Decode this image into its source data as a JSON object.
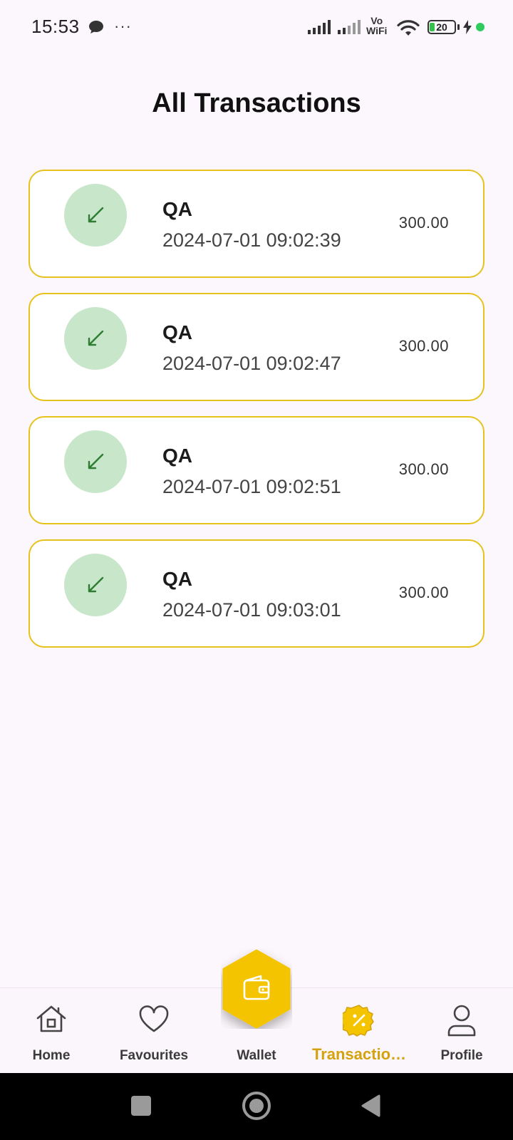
{
  "status_bar": {
    "time": "15:53",
    "more": "···",
    "vo": "Vo",
    "wifi_text": "WiFi",
    "battery": "20"
  },
  "page": {
    "title": "All Transactions"
  },
  "transactions": [
    {
      "name": "QA",
      "date": "2024-07-01 09:02:39",
      "amount": "300.00",
      "icon": "arrow-down-left-icon"
    },
    {
      "name": "QA",
      "date": "2024-07-01 09:02:47",
      "amount": "300.00",
      "icon": "arrow-down-left-icon"
    },
    {
      "name": "QA",
      "date": "2024-07-01 09:02:51",
      "amount": "300.00",
      "icon": "arrow-down-left-icon"
    },
    {
      "name": "QA",
      "date": "2024-07-01 09:03:01",
      "amount": "300.00",
      "icon": "arrow-down-left-icon"
    }
  ],
  "bottom_nav": {
    "items": [
      {
        "label": "Home",
        "icon": "home-icon"
      },
      {
        "label": "Favourites",
        "icon": "heart-icon"
      },
      {
        "label": "Wallet",
        "icon": "wallet-icon"
      },
      {
        "label": "Transactio…",
        "icon": "discount-badge-icon"
      },
      {
        "label": "Profile",
        "icon": "user-icon"
      }
    ],
    "active": "Transactio…"
  },
  "colors": {
    "accent": "#f5c400",
    "active_label": "#d4a20c",
    "card_border": "#e8c21c",
    "icon_bg": "#c8e6c9",
    "icon_fg": "#2e7d32",
    "background": "#fcf6fd"
  }
}
